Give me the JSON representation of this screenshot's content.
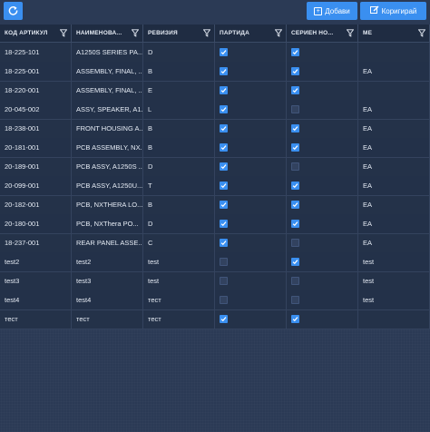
{
  "toolbar": {
    "add_label": "Добави",
    "edit_label": "Коригирай"
  },
  "columns": [
    {
      "label": "КОД АРТИКУЛ"
    },
    {
      "label": "НАИМЕНОВА..."
    },
    {
      "label": "РЕВИЗИЯ"
    },
    {
      "label": "ПАРТИДА"
    },
    {
      "label": "СЕРИЕН НО..."
    },
    {
      "label": "МЕ"
    }
  ],
  "rows": [
    {
      "code": "18-225-101",
      "name": "A1250S SERIES PA...",
      "rev": "D",
      "batch": true,
      "serial": true,
      "unit": ""
    },
    {
      "code": "18-225-001",
      "name": "ASSEMBLY, FINAL, ...",
      "rev": "B",
      "batch": true,
      "serial": true,
      "unit": "EA"
    },
    {
      "code": "18-220-001",
      "name": "ASSEMBLY, FINAL, ...",
      "rev": "E",
      "batch": true,
      "serial": true,
      "unit": ""
    },
    {
      "code": "20-045-002",
      "name": "ASSY, SPEAKER, A1...",
      "rev": "L",
      "batch": true,
      "serial": false,
      "unit": "EA"
    },
    {
      "code": "18-238-001",
      "name": "FRONT HOUSING A...",
      "rev": "B",
      "batch": true,
      "serial": true,
      "unit": "EA"
    },
    {
      "code": "20-181-001",
      "name": "PCB ASSEMBLY, NX...",
      "rev": "B",
      "batch": true,
      "serial": true,
      "unit": "EA"
    },
    {
      "code": "20-189-001",
      "name": "PCB ASSY, A1250S ...",
      "rev": "D",
      "batch": true,
      "serial": false,
      "unit": "EA"
    },
    {
      "code": "20-099-001",
      "name": "PCB ASSY, A1250U...",
      "rev": "T",
      "batch": true,
      "serial": true,
      "unit": "EA"
    },
    {
      "code": "20-182-001",
      "name": "PCB, NXTHERA LO...",
      "rev": "B",
      "batch": true,
      "serial": true,
      "unit": "EA"
    },
    {
      "code": "20-180-001",
      "name": "PCB, NXThera PO...",
      "rev": "D",
      "batch": true,
      "serial": true,
      "unit": "EA"
    },
    {
      "code": "18-237-001",
      "name": "REAR PANEL ASSE...",
      "rev": "C",
      "batch": true,
      "serial": false,
      "unit": "EA"
    },
    {
      "code": "test2",
      "name": "test2",
      "rev": "test",
      "batch": false,
      "serial": true,
      "unit": "test"
    },
    {
      "code": "test3",
      "name": "test3",
      "rev": "test",
      "batch": false,
      "serial": false,
      "unit": "test"
    },
    {
      "code": "test4",
      "name": "test4",
      "rev": "тест",
      "batch": false,
      "serial": false,
      "unit": "test"
    },
    {
      "code": "тест",
      "name": "тест",
      "rev": "тест",
      "batch": true,
      "serial": true,
      "unit": ""
    }
  ],
  "icons": {
    "refresh": "refresh-icon",
    "add": "plus-square-icon",
    "edit": "edit-icon",
    "filter": "filter-icon",
    "check": "checkmark-icon"
  },
  "colors": {
    "accent": "#3a8ff0",
    "background": "#2b3a55",
    "grid": "#243249"
  }
}
